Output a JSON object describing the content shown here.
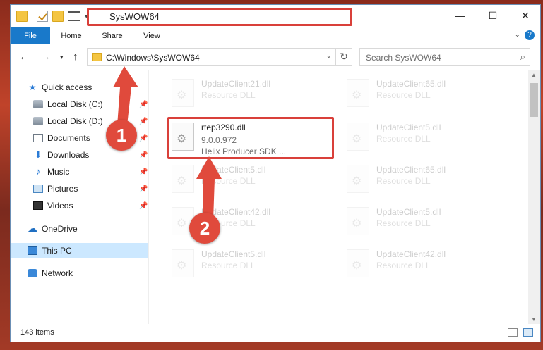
{
  "window": {
    "title": "SysWOW64",
    "controls": [
      "minimize-icon",
      "maximize-icon",
      "close-icon"
    ]
  },
  "ribbon": {
    "tabs": [
      {
        "label": "File",
        "active": true
      },
      {
        "label": "Home"
      },
      {
        "label": "Share"
      },
      {
        "label": "View"
      }
    ],
    "help": "?"
  },
  "navigation": {
    "address": "C:\\Windows\\SysWOW64",
    "search_placeholder": "Search SysWOW64"
  },
  "sidebar": {
    "items": [
      {
        "label": "Quick access",
        "icon": "star-icon"
      },
      {
        "label": "Local Disk (C:)",
        "icon": "disk-icon",
        "pinned": true
      },
      {
        "label": "Local Disk (D:)",
        "icon": "disk-icon",
        "pinned": true
      },
      {
        "label": "Documents",
        "icon": "documents-icon",
        "pinned": true
      },
      {
        "label": "Downloads",
        "icon": "download-icon",
        "pinned": true
      },
      {
        "label": "Music",
        "icon": "music-icon",
        "pinned": true
      },
      {
        "label": "Pictures",
        "icon": "pictures-icon",
        "pinned": true
      },
      {
        "label": "Videos",
        "icon": "videos-icon",
        "pinned": true
      },
      {
        "label": "OneDrive",
        "icon": "cloud-icon"
      },
      {
        "label": "This PC",
        "icon": "computer-icon",
        "selected": true
      },
      {
        "label": "Network",
        "icon": "network-icon"
      }
    ]
  },
  "files": [
    {
      "name": "UpdateClient21.dll",
      "type": "Resource DLL",
      "faded": true
    },
    {
      "name": "UpdateClient65.dll",
      "type": "Resource DLL",
      "faded": true
    },
    {
      "name": "rtep3290.dll",
      "version": "9.0.0.972",
      "description": "Helix Producer SDK ...",
      "highlighted": true
    },
    {
      "name": "UpdateClient5.dll",
      "type": "Resource DLL",
      "faded": true
    },
    {
      "name": "UpdateClient5.dll",
      "type": "Resource DLL",
      "faded": true
    },
    {
      "name": "UpdateClient65.dll",
      "type": "Resource DLL",
      "faded": true
    },
    {
      "name": "UpdateClient42.dll",
      "type": "Resource DLL",
      "faded": true
    },
    {
      "name": "UpdateClient5.dll",
      "type": "Resource DLL",
      "faded": true
    },
    {
      "name": "UpdateClient5.dll",
      "type": "Resource DLL",
      "faded": true
    },
    {
      "name": "UpdateClient42.dll",
      "type": "Resource DLL",
      "faded": true
    }
  ],
  "status": {
    "item_count": "143 items"
  },
  "annotations": {
    "step1": "1",
    "step2": "2",
    "color": "#e04a3c"
  }
}
